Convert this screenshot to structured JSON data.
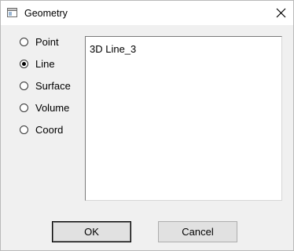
{
  "window": {
    "title": "Geometry",
    "icon": "window-app-icon",
    "close_icon": "close-icon"
  },
  "geometry_type": {
    "selected": "Line",
    "options": [
      {
        "label": "Point",
        "checked": false
      },
      {
        "label": "Line",
        "checked": true
      },
      {
        "label": "Surface",
        "checked": false
      },
      {
        "label": "Volume",
        "checked": false
      },
      {
        "label": "Coord",
        "checked": false
      }
    ]
  },
  "list": {
    "items": [
      "3D Line_3"
    ]
  },
  "buttons": {
    "ok_label": "OK",
    "cancel_label": "Cancel"
  }
}
